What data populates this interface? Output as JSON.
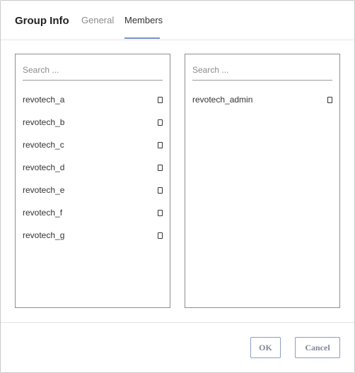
{
  "dialog": {
    "title": "Group Info"
  },
  "tabs": [
    {
      "label": "General",
      "active": false
    },
    {
      "label": "Members",
      "active": true
    }
  ],
  "left_panel": {
    "search_placeholder": "Search ...",
    "items": [
      {
        "label": "revotech_a"
      },
      {
        "label": "revotech_b"
      },
      {
        "label": "revotech_c"
      },
      {
        "label": "revotech_d"
      },
      {
        "label": "revotech_e"
      },
      {
        "label": "revotech_f"
      },
      {
        "label": "revotech_g"
      }
    ]
  },
  "right_panel": {
    "search_placeholder": "Search ...",
    "items": [
      {
        "label": "revotech_admin"
      }
    ]
  },
  "footer": {
    "ok_label": "OK",
    "cancel_label": "Cancel"
  },
  "colors": {
    "accent": "#7a8fc7",
    "button_border": "#8c9cc4",
    "panel_border": "#8f8f8f"
  },
  "icons": {
    "item_marker": "checkbox-icon"
  }
}
